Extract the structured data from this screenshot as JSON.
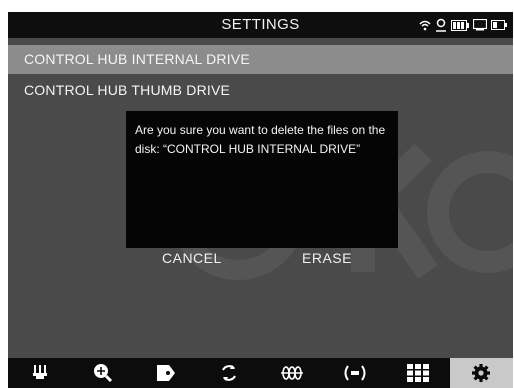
{
  "header": {
    "title": "SETTINGS"
  },
  "status_icons": [
    "wifi-icon",
    "location-icon",
    "battery-icon",
    "monitor-icon",
    "battery-small-icon"
  ],
  "drives": [
    {
      "label": "CONTROL HUB INTERNAL DRIVE",
      "selected": true
    },
    {
      "label": "CONTROL HUB THUMB DRIVE",
      "selected": false
    }
  ],
  "dialog": {
    "message": "Are you sure you want to delete the files on the disk: “CONTROL HUB INTERNAL DRIVE”",
    "cancel_label": "CANCEL",
    "erase_label": "ERASE"
  },
  "toolbar": {
    "icons": [
      "probe-icon",
      "zoom-in-icon",
      "tag-icon",
      "rotate-icon",
      "waveform-icon",
      "broadcast-icon",
      "grid-icon",
      "gear-icon"
    ],
    "active": "gear-icon"
  },
  "colors": {
    "background": "#4a4a4a",
    "selected_row": "#8c8c8c",
    "bar": "#0e0e0e",
    "active_tool": "#c9c9c9"
  }
}
